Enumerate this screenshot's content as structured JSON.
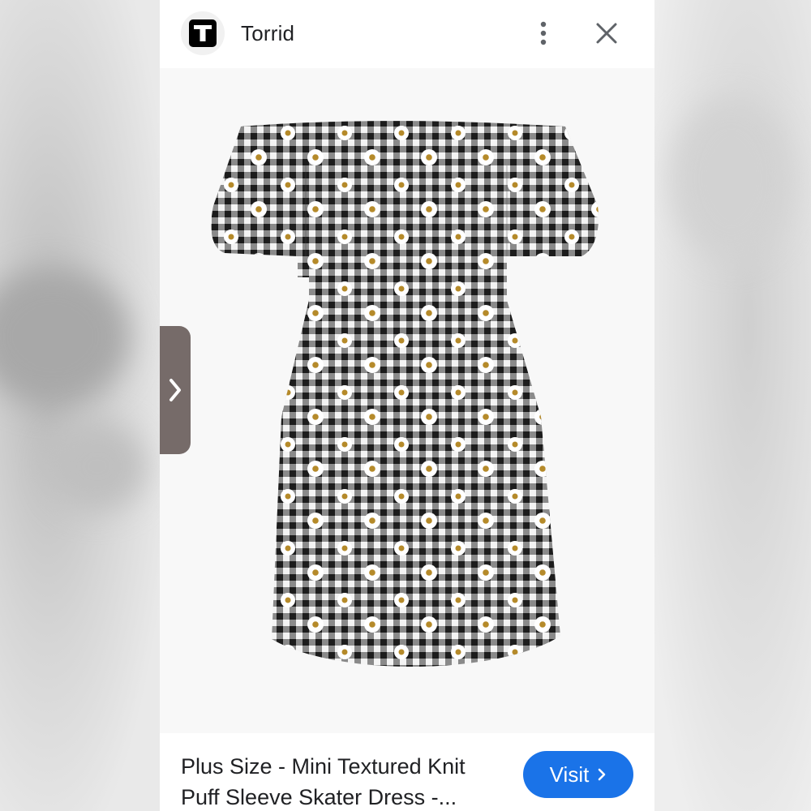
{
  "header": {
    "logo_letter": "T",
    "site_name": "Torrid",
    "menu_icon": "more-vert-icon",
    "close_icon": "close-icon"
  },
  "product": {
    "title_line1": "Plus Size - Mini Textured Knit",
    "title_line2": "Puff Sleeve Skater Dress -...",
    "image_description_icon": "dress-image"
  },
  "actions": {
    "visit_label": "Visit",
    "visit_icon": "chevron-right-icon",
    "next_icon": "chevron-right-icon"
  },
  "colors": {
    "accent": "#1a73e8",
    "arrow_bg": "#766b69"
  }
}
